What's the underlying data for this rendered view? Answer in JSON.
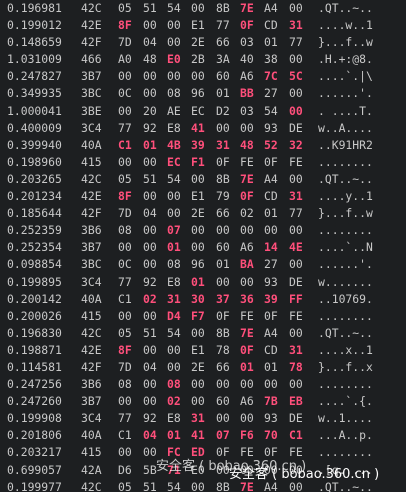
{
  "rows": [
    {
      "time": "0.196981",
      "id": "42C",
      "b": [
        "05",
        "51",
        "54",
        "00",
        "8B",
        "7E",
        "A4",
        "00"
      ],
      "hl": [
        5
      ],
      "ascii": ".QT..~.."
    },
    {
      "time": "0.199012",
      "id": "42E",
      "b": [
        "8F",
        "00",
        "00",
        "E1",
        "77",
        "0F",
        "CD",
        "31"
      ],
      "hl": [
        0,
        5,
        7
      ],
      "ascii": "....w..1"
    },
    {
      "time": "0.148659",
      "id": "42F",
      "b": [
        "7D",
        "04",
        "00",
        "2E",
        "66",
        "03",
        "01",
        "77"
      ],
      "hl": [],
      "ascii": "}...f..w"
    },
    {
      "time": "1.031009",
      "id": "466",
      "b": [
        "A0",
        "48",
        "E0",
        "2B",
        "3A",
        "40",
        "38",
        "00"
      ],
      "hl": [
        2
      ],
      "ascii": ".H.+:@8."
    },
    {
      "time": "0.247827",
      "id": "3B7",
      "b": [
        "00",
        "00",
        "00",
        "00",
        "60",
        "A6",
        "7C",
        "5C"
      ],
      "hl": [
        6,
        7
      ],
      "ascii": "....`.|\\"
    },
    {
      "time": "0.349935",
      "id": "3BC",
      "b": [
        "0C",
        "00",
        "08",
        "96",
        "01",
        "BB",
        "27",
        "00"
      ],
      "hl": [
        5
      ],
      "ascii": "......'."
    },
    {
      "time": "1.000041",
      "id": "3BE",
      "b": [
        "00",
        "20",
        "AE",
        "EC",
        "D2",
        "03",
        "54",
        "00"
      ],
      "hl": [
        7
      ],
      "ascii": ". ....T."
    },
    {
      "time": "0.400009",
      "id": "3C4",
      "b": [
        "77",
        "92",
        "E8",
        "41",
        "00",
        "00",
        "93",
        "DE"
      ],
      "hl": [
        3
      ],
      "ascii": "w..A...."
    },
    {
      "time": "0.399940",
      "id": "40A",
      "b": [
        "C1",
        "01",
        "4B",
        "39",
        "31",
        "48",
        "52",
        "32"
      ],
      "hl": [
        0,
        1,
        2,
        3,
        4,
        5,
        6,
        7
      ],
      "ascii": "..K91HR2"
    },
    {
      "time": "0.198960",
      "id": "415",
      "b": [
        "00",
        "00",
        "EC",
        "F1",
        "0F",
        "FE",
        "0F",
        "FE"
      ],
      "hl": [
        2,
        3
      ],
      "ascii": "........"
    },
    {
      "time": "0.203265",
      "id": "42C",
      "b": [
        "05",
        "51",
        "54",
        "00",
        "8B",
        "7E",
        "A4",
        "00"
      ],
      "hl": [
        5
      ],
      "ascii": ".QT..~.."
    },
    {
      "time": "0.201234",
      "id": "42E",
      "b": [
        "8F",
        "00",
        "00",
        "E1",
        "79",
        "0F",
        "CD",
        "31"
      ],
      "hl": [
        0,
        5,
        7
      ],
      "ascii": "....y..1"
    },
    {
      "time": "0.185644",
      "id": "42F",
      "b": [
        "7D",
        "04",
        "00",
        "2E",
        "66",
        "02",
        "01",
        "77"
      ],
      "hl": [],
      "ascii": "}...f..w"
    },
    {
      "time": "0.252359",
      "id": "3B6",
      "b": [
        "08",
        "00",
        "07",
        "00",
        "00",
        "00",
        "00",
        "00"
      ],
      "hl": [
        2
      ],
      "ascii": "........"
    },
    {
      "time": "0.252354",
      "id": "3B7",
      "b": [
        "00",
        "00",
        "01",
        "00",
        "60",
        "A6",
        "14",
        "4E"
      ],
      "hl": [
        2,
        6,
        7
      ],
      "ascii": "....`..N"
    },
    {
      "time": "0.098854",
      "id": "3BC",
      "b": [
        "0C",
        "00",
        "08",
        "96",
        "01",
        "BA",
        "27",
        "00"
      ],
      "hl": [
        5
      ],
      "ascii": "......'."
    },
    {
      "time": "0.199895",
      "id": "3C4",
      "b": [
        "77",
        "92",
        "E8",
        "01",
        "00",
        "00",
        "93",
        "DE"
      ],
      "hl": [
        3
      ],
      "ascii": "w......."
    },
    {
      "time": "0.200142",
      "id": "40A",
      "b": [
        "C1",
        "02",
        "31",
        "30",
        "37",
        "36",
        "39",
        "FF"
      ],
      "hl": [
        1,
        2,
        3,
        4,
        5,
        6,
        7
      ],
      "ascii": "..10769."
    },
    {
      "time": "0.200026",
      "id": "415",
      "b": [
        "00",
        "00",
        "D4",
        "F7",
        "0F",
        "FE",
        "0F",
        "FE"
      ],
      "hl": [
        2,
        3
      ],
      "ascii": "........"
    },
    {
      "time": "0.196830",
      "id": "42C",
      "b": [
        "05",
        "51",
        "54",
        "00",
        "8B",
        "7E",
        "A4",
        "00"
      ],
      "hl": [
        5
      ],
      "ascii": ".QT..~.."
    },
    {
      "time": "0.198871",
      "id": "42E",
      "b": [
        "8F",
        "00",
        "00",
        "E1",
        "78",
        "0F",
        "CD",
        "31"
      ],
      "hl": [
        0,
        5,
        7
      ],
      "ascii": "....x..1"
    },
    {
      "time": "0.114581",
      "id": "42F",
      "b": [
        "7D",
        "04",
        "00",
        "2E",
        "66",
        "01",
        "01",
        "78"
      ],
      "hl": [
        5,
        7
      ],
      "ascii": "}...f..x"
    },
    {
      "time": "0.247256",
      "id": "3B6",
      "b": [
        "08",
        "00",
        "08",
        "00",
        "00",
        "00",
        "00",
        "00"
      ],
      "hl": [
        2
      ],
      "ascii": "........"
    },
    {
      "time": "0.247260",
      "id": "3B7",
      "b": [
        "00",
        "00",
        "02",
        "00",
        "60",
        "A6",
        "7B",
        "EB"
      ],
      "hl": [
        2,
        6,
        7
      ],
      "ascii": "....`.{."
    },
    {
      "time": "0.199908",
      "id": "3C4",
      "b": [
        "77",
        "92",
        "E8",
        "31",
        "00",
        "00",
        "93",
        "DE"
      ],
      "hl": [
        3
      ],
      "ascii": "w..1...."
    },
    {
      "time": "0.201806",
      "id": "40A",
      "b": [
        "C1",
        "04",
        "01",
        "41",
        "07",
        "F6",
        "70",
        "C1"
      ],
      "hl": [
        1,
        2,
        3,
        4,
        5,
        6,
        7
      ],
      "ascii": "...A..p."
    },
    {
      "time": "0.203217",
      "id": "415",
      "b": [
        "00",
        "00",
        "FC",
        "ED",
        "0F",
        "FE",
        "0F",
        "FE"
      ],
      "hl": [
        2,
        3
      ],
      "ascii": "........"
    },
    {
      "time": "0.699057",
      "id": "42A",
      "b": [
        "D6",
        "5B",
        "71",
        "E0",
        "00",
        "00",
        "00",
        "00"
      ],
      "hl": [
        2
      ],
      "ascii": ".[q....."
    },
    {
      "time": "0.199977",
      "id": "42C",
      "b": [
        "05",
        "51",
        "54",
        "00",
        "8B",
        "7E",
        "A4",
        "00"
      ],
      "hl": [
        5
      ],
      "ascii": ".QT..~.."
    },
    {
      "time": "0.199963",
      "id": "42E",
      "b": [
        "8F",
        "00",
        "00",
        "E1",
        "7A",
        "0F",
        "CD",
        "31"
      ],
      "hl": [
        0,
        4,
        5,
        7
      ],
      "ascii": "....z..1"
    }
  ],
  "watermark": {
    "primary": "安全客 ( bobao.360.cn )",
    "secondary": "安全客 ( bobao.360.cn )"
  }
}
